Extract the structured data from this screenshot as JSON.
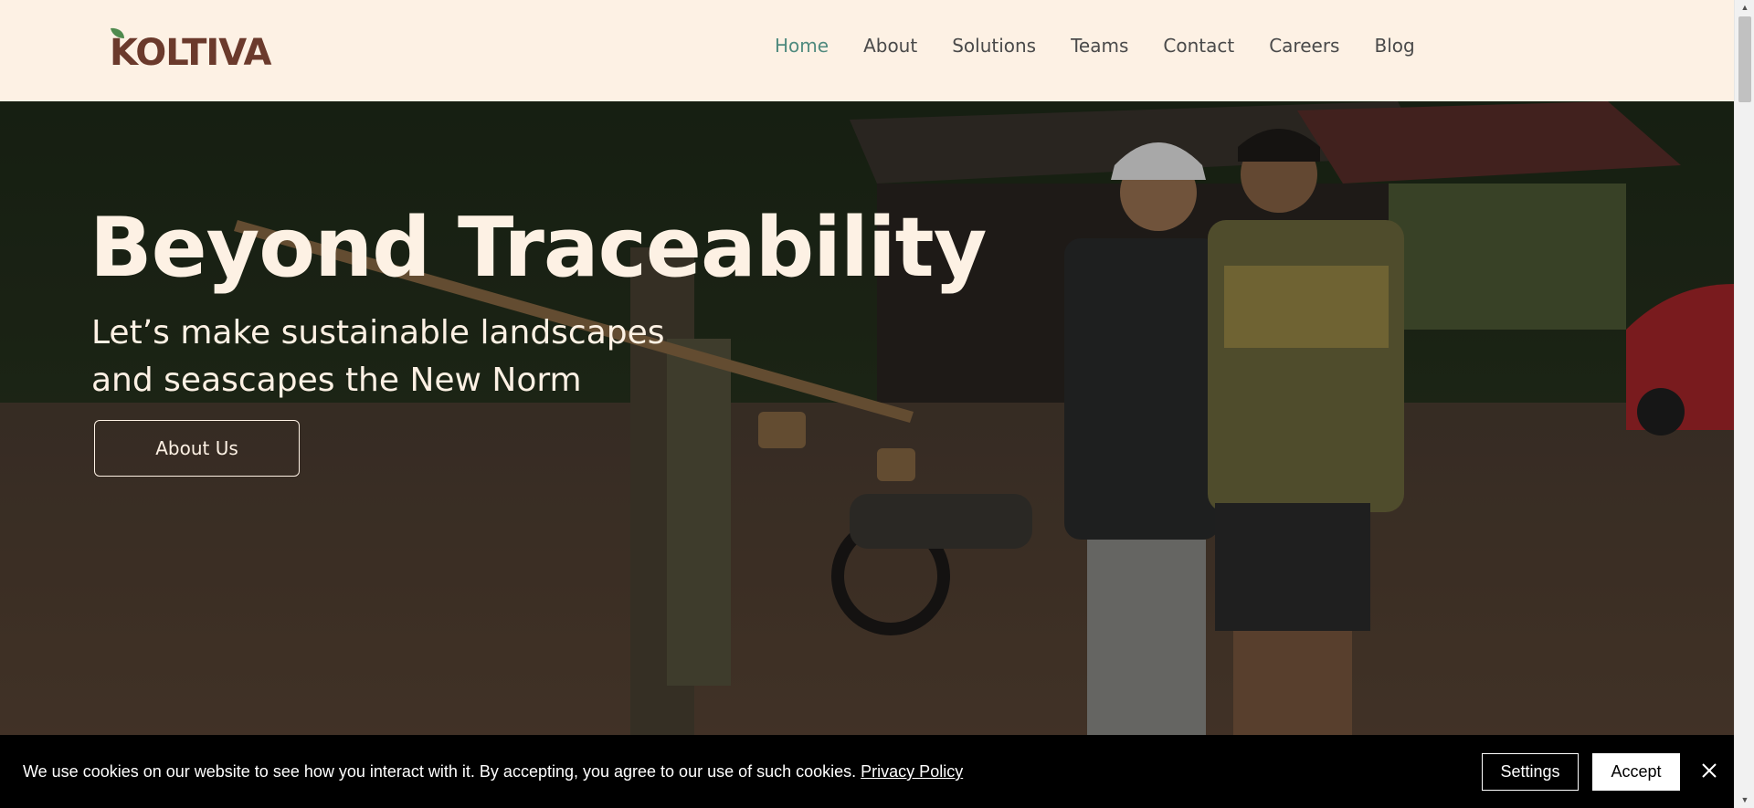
{
  "header": {
    "logo_text": "KOLTIVA",
    "nav": [
      {
        "label": "Home",
        "active": true
      },
      {
        "label": "About",
        "active": false
      },
      {
        "label": "Solutions",
        "active": false
      },
      {
        "label": "Teams",
        "active": false
      },
      {
        "label": "Contact",
        "active": false
      },
      {
        "label": "Careers",
        "active": false
      },
      {
        "label": "Blog",
        "active": false
      }
    ]
  },
  "hero": {
    "title": "Beyond Traceability",
    "subtitle": "Let’s make sustainable landscapes and seascapes the New Norm",
    "button_label": "About Us"
  },
  "cookie_banner": {
    "text": "We use cookies on our website to see how you interact with it. By accepting, you agree to our use of such cookies.",
    "link_label": "Privacy Policy",
    "settings_label": "Settings",
    "accept_label": "Accept"
  },
  "colors": {
    "header_bg": "#fdf1e4",
    "nav_active": "#4f8a7e",
    "logo_brown": "#6b3a2c",
    "logo_leaf": "#4f8a4e",
    "hero_text": "#fdf1e4",
    "banner_bg": "#000000"
  },
  "icons": {
    "logo_leaf": "leaf-icon",
    "close": "close-icon",
    "scroll_up": "chevron-up-icon",
    "scroll_down": "chevron-down-icon"
  }
}
